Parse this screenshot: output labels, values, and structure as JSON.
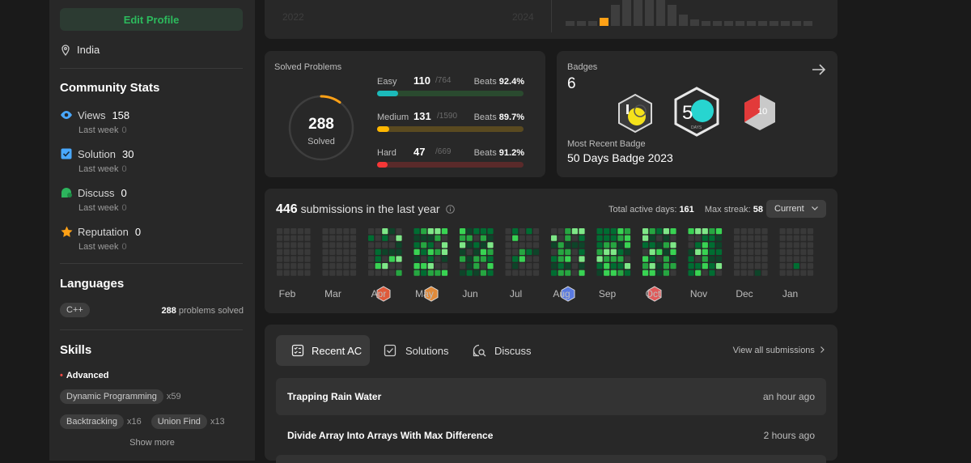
{
  "sidebar": {
    "edit_profile": "Edit Profile",
    "location": "India",
    "community_title": "Community Stats",
    "stats": [
      {
        "label": "Views",
        "value": "158",
        "sub": "Last week",
        "delta": "0",
        "color": "#49a8ff"
      },
      {
        "label": "Solution",
        "value": "30",
        "sub": "Last week",
        "delta": "0",
        "color": "#49a8ff"
      },
      {
        "label": "Discuss",
        "value": "0",
        "sub": "Last week",
        "delta": "0",
        "color": "#2db55d"
      },
      {
        "label": "Reputation",
        "value": "0",
        "sub": "Last week",
        "delta": "0",
        "color": "#ffa116"
      }
    ],
    "languages_title": "Languages",
    "language": "C++",
    "language_solved": "288",
    "language_solved_suffix": " problems solved",
    "skills_title": "Skills",
    "skills_level": "Advanced",
    "skills": [
      {
        "name": "Dynamic Programming",
        "count": "x59"
      },
      {
        "name": "Backtracking",
        "count": "x16"
      },
      {
        "name": "Union Find",
        "count": "x13"
      }
    ],
    "show_more": "Show more"
  },
  "top_chart": {
    "label_left": "2022",
    "label_right": "2024"
  },
  "solved": {
    "title": "Solved Problems",
    "total": "288",
    "total_label": "Solved",
    "rows": [
      {
        "name": "Easy",
        "solved": "110",
        "total": "/764",
        "beats_label": "Beats",
        "beats": "92.4%",
        "fraction": 0.144,
        "color": "#1cbaba",
        "track": "#2a4a2f"
      },
      {
        "name": "Medium",
        "solved": "131",
        "total": "/1590",
        "beats_label": "Beats",
        "beats": "89.7%",
        "fraction": 0.082,
        "color": "#ffb700",
        "track": "#5a4a20"
      },
      {
        "name": "Hard",
        "solved": "47",
        "total": "/669",
        "beats_label": "Beats",
        "beats": "91.2%",
        "fraction": 0.07,
        "color": "#f63737",
        "track": "#5a2a2a"
      }
    ]
  },
  "badges": {
    "title": "Badges",
    "count": "6",
    "recent_label": "Most Recent Badge",
    "recent_name": "50 Days Badge 2023"
  },
  "submissions": {
    "count": "446",
    "text": "submissions in the last year",
    "active_label": "Total active days:",
    "active_value": "161",
    "streak_label": "Max streak:",
    "streak_value": "58",
    "dropdown": "Current",
    "months": [
      "Feb",
      "Mar",
      "Apr",
      "May",
      "Jun",
      "Jul",
      "Aug",
      "Sep",
      "Oct",
      "Nov",
      "Dec",
      "Jan"
    ]
  },
  "recent": {
    "tabs": [
      "Recent AC",
      "Solutions",
      "Discuss"
    ],
    "view_all": "View all submissions",
    "items": [
      {
        "title": "Trapping Rain Water",
        "time": "an hour ago"
      },
      {
        "title": "Divide Array Into Arrays With Max Difference",
        "time": "2 hours ago"
      }
    ]
  }
}
